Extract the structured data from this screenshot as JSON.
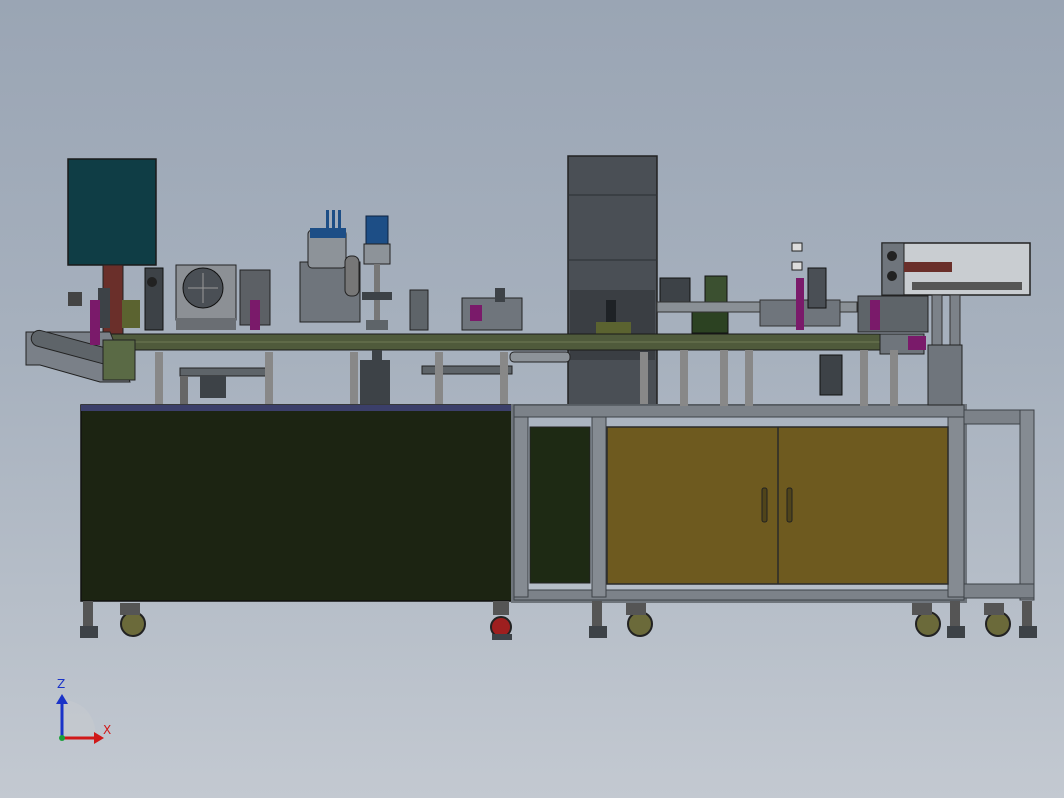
{
  "viewport": {
    "background_top": "#9aa5b4",
    "background_bottom": "#c3c9d1"
  },
  "triad": {
    "z_label": "Z",
    "x_label": "X",
    "z_color": "#1a33c8",
    "x_color": "#d01818",
    "y_color": "#1aa03a"
  },
  "colors": {
    "frame": "#6f757c",
    "frame_dark": "#3d4247",
    "panel_green": "#1c2412",
    "cabinet_door": "#6e5a1f",
    "monitor": "#0f3d45",
    "tower": "#4a4f55",
    "conveyor": "#4f5a3b",
    "accent_purple": "#7a1a6a",
    "accent_blue": "#1d4e86",
    "post_red": "#6a2f2a"
  }
}
